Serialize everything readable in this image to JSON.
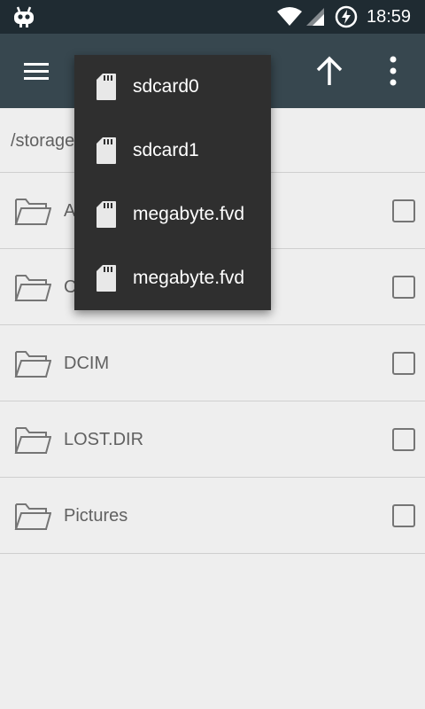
{
  "status_bar": {
    "time": "18:59"
  },
  "toolbar": {
    "menu_icon": "hamburger-icon",
    "up_icon": "arrow-up-icon",
    "overflow_icon": "more-vert-icon"
  },
  "path_bar": {
    "path": "/storage"
  },
  "file_list": {
    "items": [
      {
        "label": "A",
        "icon": "folder-icon"
      },
      {
        "label": "C",
        "icon": "folder-icon"
      },
      {
        "label": "DCIM",
        "icon": "folder-icon"
      },
      {
        "label": "LOST.DIR",
        "icon": "folder-icon"
      },
      {
        "label": "Pictures",
        "icon": "folder-icon"
      }
    ]
  },
  "storage_menu": {
    "items": [
      {
        "label": "sdcard0",
        "icon": "sd-card-icon"
      },
      {
        "label": "sdcard1",
        "icon": "sd-card-icon"
      },
      {
        "label": "megabyte.fvd",
        "icon": "sd-card-icon"
      },
      {
        "label": "megabyte.fvd",
        "icon": "sd-card-icon"
      }
    ]
  },
  "colors": {
    "status_bar": "#1f2b32",
    "toolbar": "#37474f",
    "background": "#eeeeee",
    "menu_background": "#2f2f2f",
    "text": "#616161"
  }
}
